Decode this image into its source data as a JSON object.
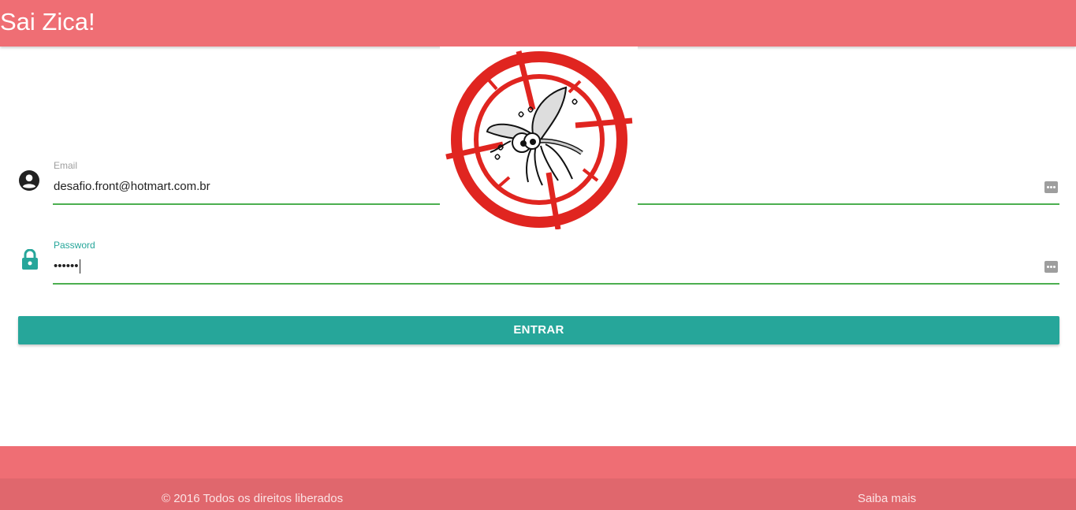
{
  "header": {
    "brand": "Sai Zica!"
  },
  "form": {
    "email": {
      "label": "Email",
      "value": "desafio.front@hotmart.com.br",
      "label_color": "#9e9e9e"
    },
    "password": {
      "label": "Password",
      "value": "••••••",
      "label_color": "#26a69a"
    },
    "submit_label": "ENTRAR"
  },
  "footer": {
    "copyright": "© 2016 Todos os direitos liberados",
    "link": "Saiba mais"
  },
  "colors": {
    "primary": "#ef6e74",
    "accent": "#26a69a",
    "valid": "#4caf50"
  },
  "icons": [
    "account-circle-icon",
    "lock-icon",
    "more-horizontal-icon",
    "mosquito-target-logo"
  ]
}
